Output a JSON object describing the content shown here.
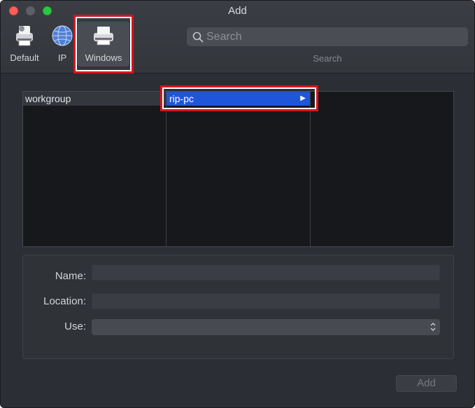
{
  "window": {
    "title": "Add"
  },
  "toolbar": {
    "default_label": "Default",
    "ip_label": "IP",
    "windows_label": "Windows"
  },
  "search": {
    "placeholder": "Search",
    "caption": "Search"
  },
  "browser": {
    "column1": {
      "items": [
        "workgroup"
      ]
    },
    "column2": {
      "items": [
        "rip-pc"
      ],
      "selected": "rip-pc"
    }
  },
  "form": {
    "name_label": "Name:",
    "name_value": "",
    "location_label": "Location:",
    "location_value": "",
    "use_label": "Use:",
    "use_value": ""
  },
  "footer": {
    "add_button_label": "Add"
  },
  "colors": {
    "window_bg": "#2b2e34",
    "selection": "#1f56d9",
    "highlight_box": "#d7141e",
    "close": "#fc5f57",
    "maximize": "#2ac841"
  },
  "icons": [
    "close-icon",
    "minimize-icon",
    "maximize-icon",
    "printer-default-icon",
    "globe-icon",
    "printer-windows-icon",
    "search-icon",
    "chevron-right-icon",
    "updown-chevron-icon"
  ]
}
